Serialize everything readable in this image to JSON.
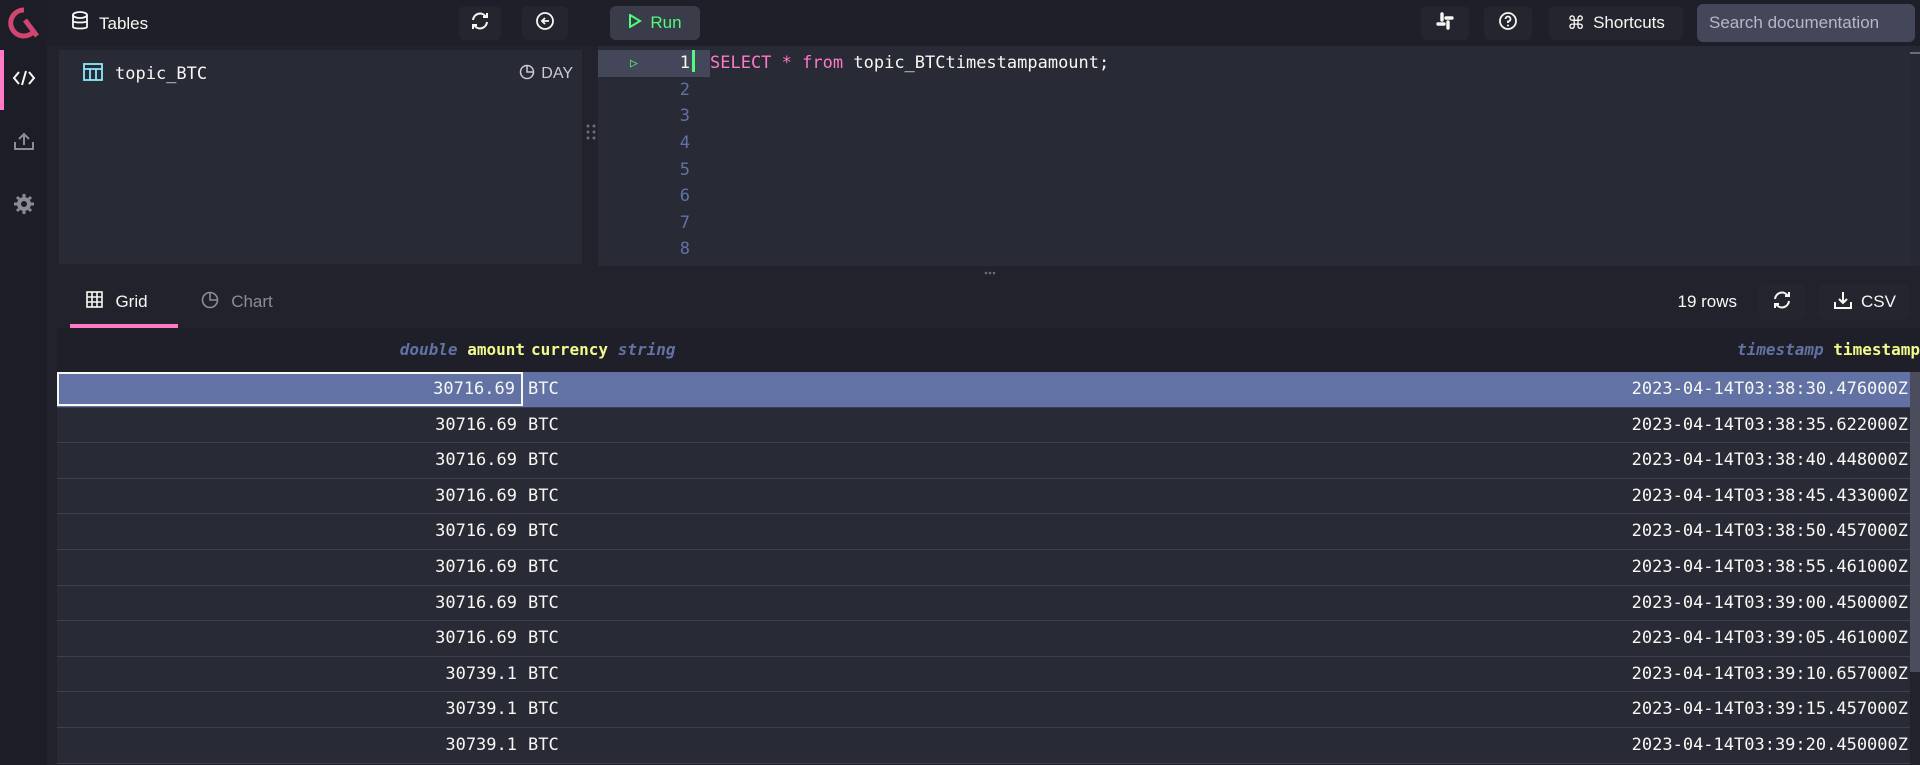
{
  "rail": {
    "items": [
      {
        "name": "code-icon",
        "active": true
      },
      {
        "name": "upload-icon",
        "active": false
      },
      {
        "name": "gear-icon",
        "active": false
      }
    ]
  },
  "topbar": {
    "title": "Tables",
    "run_label": "Run",
    "shortcuts_label": "Shortcuts",
    "search_placeholder": "Search documentation"
  },
  "schema": {
    "tables": [
      {
        "name": "topic_BTC",
        "partition": "DAY"
      }
    ]
  },
  "editor": {
    "line_numbers": [
      "1",
      "2",
      "3",
      "4",
      "5",
      "6",
      "7",
      "8"
    ],
    "active_line": 1,
    "code": {
      "keyword1": "SELECT",
      "star": "*",
      "keyword2": "from",
      "rest": "topic_BTCtimestampamount;"
    }
  },
  "results": {
    "tabs": [
      {
        "label": "Grid",
        "active": true
      },
      {
        "label": "Chart",
        "active": false
      }
    ],
    "row_count": "19 rows",
    "csv_label": "CSV",
    "columns": [
      {
        "type": "double",
        "name": "amount"
      },
      {
        "name": "currency",
        "type": "string"
      },
      {
        "type": "timestamp",
        "name": "timestamp"
      }
    ],
    "rows": [
      {
        "amount": "30716.69",
        "currency": "BTC",
        "timestamp": "2023-04-14T03:38:30.476000Z"
      },
      {
        "amount": "30716.69",
        "currency": "BTC",
        "timestamp": "2023-04-14T03:38:35.622000Z"
      },
      {
        "amount": "30716.69",
        "currency": "BTC",
        "timestamp": "2023-04-14T03:38:40.448000Z"
      },
      {
        "amount": "30716.69",
        "currency": "BTC",
        "timestamp": "2023-04-14T03:38:45.433000Z"
      },
      {
        "amount": "30716.69",
        "currency": "BTC",
        "timestamp": "2023-04-14T03:38:50.457000Z"
      },
      {
        "amount": "30716.69",
        "currency": "BTC",
        "timestamp": "2023-04-14T03:38:55.461000Z"
      },
      {
        "amount": "30716.69",
        "currency": "BTC",
        "timestamp": "2023-04-14T03:39:00.450000Z"
      },
      {
        "amount": "30716.69",
        "currency": "BTC",
        "timestamp": "2023-04-14T03:39:05.461000Z"
      },
      {
        "amount": "30739.1",
        "currency": "BTC",
        "timestamp": "2023-04-14T03:39:10.657000Z"
      },
      {
        "amount": "30739.1",
        "currency": "BTC",
        "timestamp": "2023-04-14T03:39:15.457000Z"
      },
      {
        "amount": "30739.1",
        "currency": "BTC",
        "timestamp": "2023-04-14T03:39:20.450000Z"
      }
    ],
    "selected_row": 0
  },
  "colors": {
    "accent": "#ff79c6",
    "run_green": "#50fa7b",
    "selection": "#6272a4",
    "column_name": "#f1fa8c",
    "column_type": "#6272a4"
  }
}
